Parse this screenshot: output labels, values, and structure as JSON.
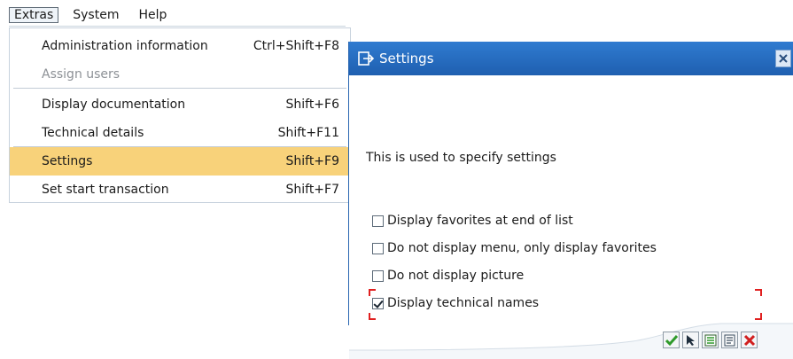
{
  "menubar": {
    "items": [
      {
        "label": "Extras",
        "active": true
      },
      {
        "label": "System",
        "active": false
      },
      {
        "label": "Help",
        "active": false
      }
    ]
  },
  "extras_menu": {
    "items": [
      {
        "label": "Administration information",
        "shortcut": "Ctrl+Shift+F8",
        "enabled": true
      },
      {
        "label": "Assign users",
        "shortcut": "",
        "enabled": false
      },
      {
        "label": "Display documentation",
        "shortcut": "Shift+F6",
        "enabled": true
      },
      {
        "label": "Technical details",
        "shortcut": "Shift+F11",
        "enabled": true
      },
      {
        "label": "Settings",
        "shortcut": "Shift+F9",
        "enabled": true,
        "highlighted": true
      },
      {
        "label": "Set start transaction",
        "shortcut": "Shift+F7",
        "enabled": true
      }
    ]
  },
  "settings_dialog": {
    "title": "Settings",
    "intro": "This is used to specify settings",
    "options": [
      {
        "label": "Display favorites at end of list",
        "checked": false
      },
      {
        "label": "Do not display menu, only display favorites",
        "checked": false
      },
      {
        "label": "Do not display picture",
        "checked": false
      },
      {
        "label": "Display technical names",
        "checked": true
      }
    ],
    "toolbar_icons": [
      "check-icon",
      "cursor-icon",
      "list-icon",
      "list-doc-icon",
      "cancel-x-icon"
    ]
  },
  "colors": {
    "titlebar": "#2f7bd0",
    "menu_highlight": "#f8d27a",
    "focus_marker": "#e02020",
    "accept_green": "#2f9a2b",
    "cancel_red": "#d11f1f"
  }
}
